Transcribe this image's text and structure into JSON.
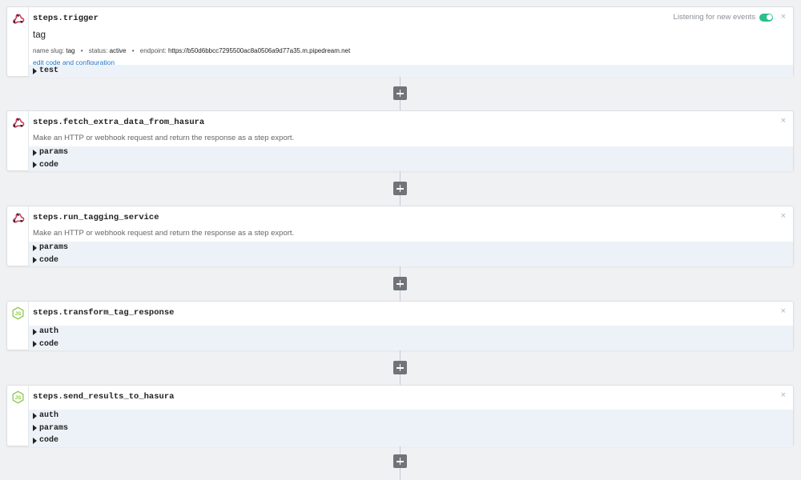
{
  "trigger": {
    "title": "steps.trigger",
    "name": "tag",
    "meta": {
      "slug_label": "name slug:",
      "slug_value": "tag",
      "status_label": "status:",
      "status_value": "active",
      "endpoint_label": "endpoint:",
      "endpoint_value": "https://b50d6bbcc7295500ac8a0506a9d77a35.m.pipedream.net",
      "separator": "•"
    },
    "edit_link": "edit code and configuration",
    "listening_text": "Listening for new events",
    "toggle_on": true,
    "sections": [
      "test"
    ],
    "close": "×"
  },
  "steps": [
    {
      "title": "steps.fetch_extra_data_from_hasura",
      "icon": "webhook-icon",
      "description": "Make an HTTP or webhook request and return the response as a step export.",
      "sections": [
        "params",
        "code"
      ],
      "close": "×"
    },
    {
      "title": "steps.run_tagging_service",
      "icon": "webhook-icon",
      "description": "Make an HTTP or webhook request and return the response as a step export.",
      "sections": [
        "params",
        "code"
      ],
      "close": "×"
    },
    {
      "title": "steps.transform_tag_response",
      "icon": "nodejs-icon",
      "description": "",
      "sections": [
        "auth",
        "code"
      ],
      "close": "×"
    },
    {
      "title": "steps.send_results_to_hasura",
      "icon": "nodejs-icon",
      "description": "",
      "sections": [
        "auth",
        "params",
        "code"
      ],
      "close": "×"
    }
  ],
  "colors": {
    "webhook": "#c93c5b",
    "nodejs": "#8cc84b",
    "link": "#1a73c7",
    "toggle": "#2bbf8a",
    "section_bg": "#edf2f8"
  }
}
